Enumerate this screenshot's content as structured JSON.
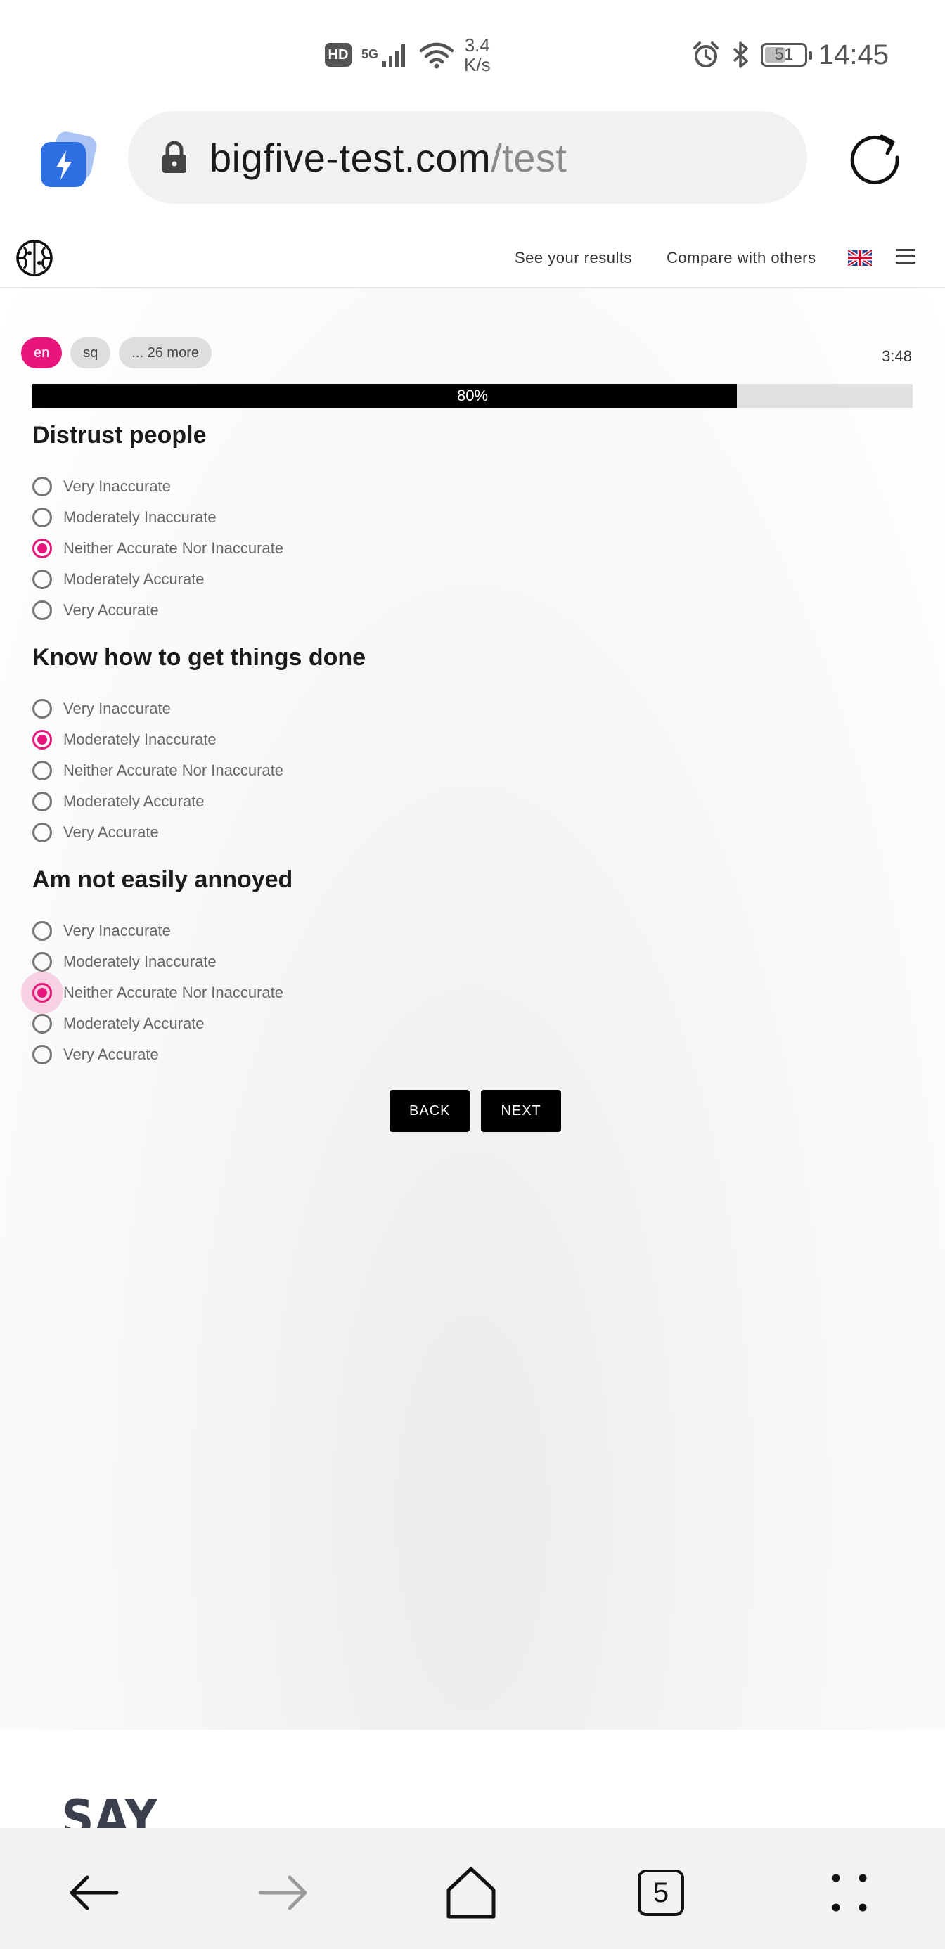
{
  "status_bar": {
    "hd_badge": "HD",
    "network": "5G",
    "speed_value": "3.4",
    "speed_unit": "K/s",
    "battery": "51",
    "time": "14:45"
  },
  "browser": {
    "url_domain": "bigfive-test.com",
    "url_path": "/test",
    "tab_count": "5"
  },
  "site_nav": {
    "results_link": "See your results",
    "compare_link": "Compare with others"
  },
  "languages": {
    "chips": [
      "en",
      "sq",
      "... 26 more"
    ],
    "active_index": 0
  },
  "timer": "3:48",
  "progress": {
    "value": 0.8,
    "label": "80%"
  },
  "questions": [
    {
      "title": "Distrust people",
      "options": [
        "Very Inaccurate",
        "Moderately Inaccurate",
        "Neither Accurate Nor Inaccurate",
        "Moderately Accurate",
        "Very Accurate"
      ],
      "selected_index": 2
    },
    {
      "title": "Know how to get things done",
      "options": [
        "Very Inaccurate",
        "Moderately Inaccurate",
        "Neither Accurate Nor Inaccurate",
        "Moderately Accurate",
        "Very Accurate"
      ],
      "selected_index": 1
    },
    {
      "title": "Am not easily annoyed",
      "options": [
        "Very Inaccurate",
        "Moderately Inaccurate",
        "Neither Accurate Nor Inaccurate",
        "Moderately Accurate",
        "Very Accurate"
      ],
      "selected_index": 2
    }
  ],
  "buttons": {
    "back": "BACK",
    "next": "NEXT"
  },
  "footer_logo": "SAY",
  "colors": {
    "accent": "#e8157a",
    "progress_fill": "#000000",
    "progress_track": "#e0e0e0"
  },
  "icons": {
    "app": "lightning-bolt-icon",
    "lock": "lock-icon",
    "reload": "reload-icon",
    "brain": "brain-icon",
    "flag": "uk-flag-icon",
    "menu": "hamburger-menu-icon",
    "back": "arrow-left-icon",
    "forward": "arrow-right-icon",
    "home": "home-icon",
    "more": "more-dots-icon"
  }
}
